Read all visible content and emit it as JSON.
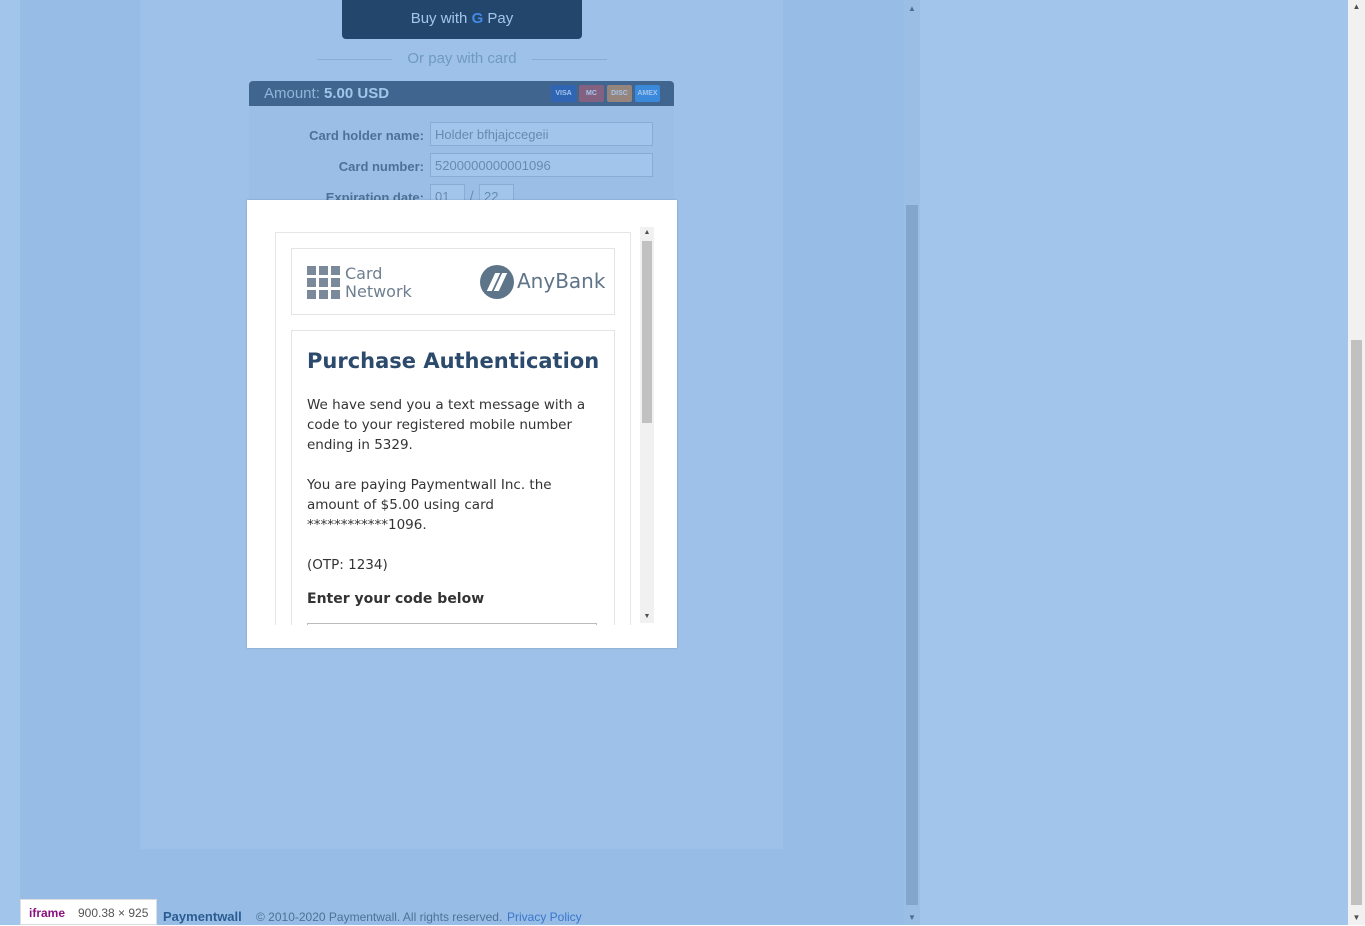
{
  "widget": {
    "gpay_prefix": "Buy with",
    "gpay_g": "G",
    "gpay_suffix": "Pay",
    "or_pay": "Or pay with card",
    "amount_label": "Amount:",
    "amount_value": "5.00 USD",
    "card_brands": [
      "VISA",
      "MC",
      "DISC",
      "AMEX"
    ],
    "form": {
      "holder_label": "Card holder name:",
      "holder_value": "Holder bfhjajccegeii",
      "number_label": "Card number:",
      "number_value": "5200000000001096",
      "exp_label": "Expiration date:",
      "exp_month": "01",
      "exp_sep": "/",
      "exp_year": "22"
    }
  },
  "modal": {
    "logo_left": "Card Network",
    "logo_left_line1": "Card",
    "logo_left_line2": "Network",
    "logo_right": "AnyBank",
    "title": "Purchase Authentication",
    "para1": "We have send you a text message with a code to your registered mobile number ending in 5329.",
    "para2": "You are paying Paymentwall Inc. the amount of $5.00 using card ************1096.",
    "otp": "(OTP: 1234)",
    "enter_code_label": "Enter your code below"
  },
  "footer": {
    "brand": "Paymentwall",
    "copyright": "© 2010-2020 Paymentwall. All rights reserved.",
    "privacy": "Privacy Policy"
  },
  "devtools_tooltip": {
    "tag": "iframe",
    "dims": "900.38 × 925"
  }
}
